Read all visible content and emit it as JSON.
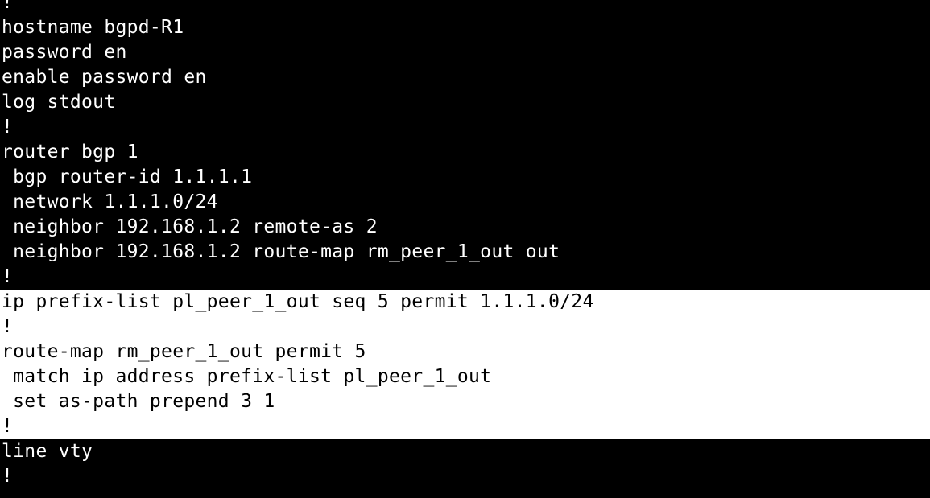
{
  "colors": {
    "background": "#000000",
    "foreground": "#ffffff",
    "selection_background": "#ffffff",
    "selection_foreground": "#000000"
  },
  "lines": [
    {
      "text": "!",
      "selected": false
    },
    {
      "text": "hostname bgpd-R1",
      "selected": false
    },
    {
      "text": "password en",
      "selected": false
    },
    {
      "text": "enable password en",
      "selected": false
    },
    {
      "text": "log stdout",
      "selected": false
    },
    {
      "text": "!",
      "selected": false
    },
    {
      "text": "router bgp 1",
      "selected": false
    },
    {
      "text": " bgp router-id 1.1.1.1",
      "selected": false
    },
    {
      "text": " network 1.1.1.0/24",
      "selected": false
    },
    {
      "text": " neighbor 192.168.1.2 remote-as 2",
      "selected": false
    },
    {
      "text": " neighbor 192.168.1.2 route-map rm_peer_1_out out",
      "selected": false
    },
    {
      "text": "!",
      "selected": false
    },
    {
      "text": "ip prefix-list pl_peer_1_out seq 5 permit 1.1.1.0/24",
      "selected": true
    },
    {
      "text": "!",
      "selected": true
    },
    {
      "text": "route-map rm_peer_1_out permit 5",
      "selected": true
    },
    {
      "text": " match ip address prefix-list pl_peer_1_out",
      "selected": true
    },
    {
      "text": " set as-path prepend 3 1",
      "selected": true
    },
    {
      "text": "!",
      "selected": true
    },
    {
      "text": "line vty",
      "selected": false
    },
    {
      "text": "!",
      "selected": false
    }
  ]
}
